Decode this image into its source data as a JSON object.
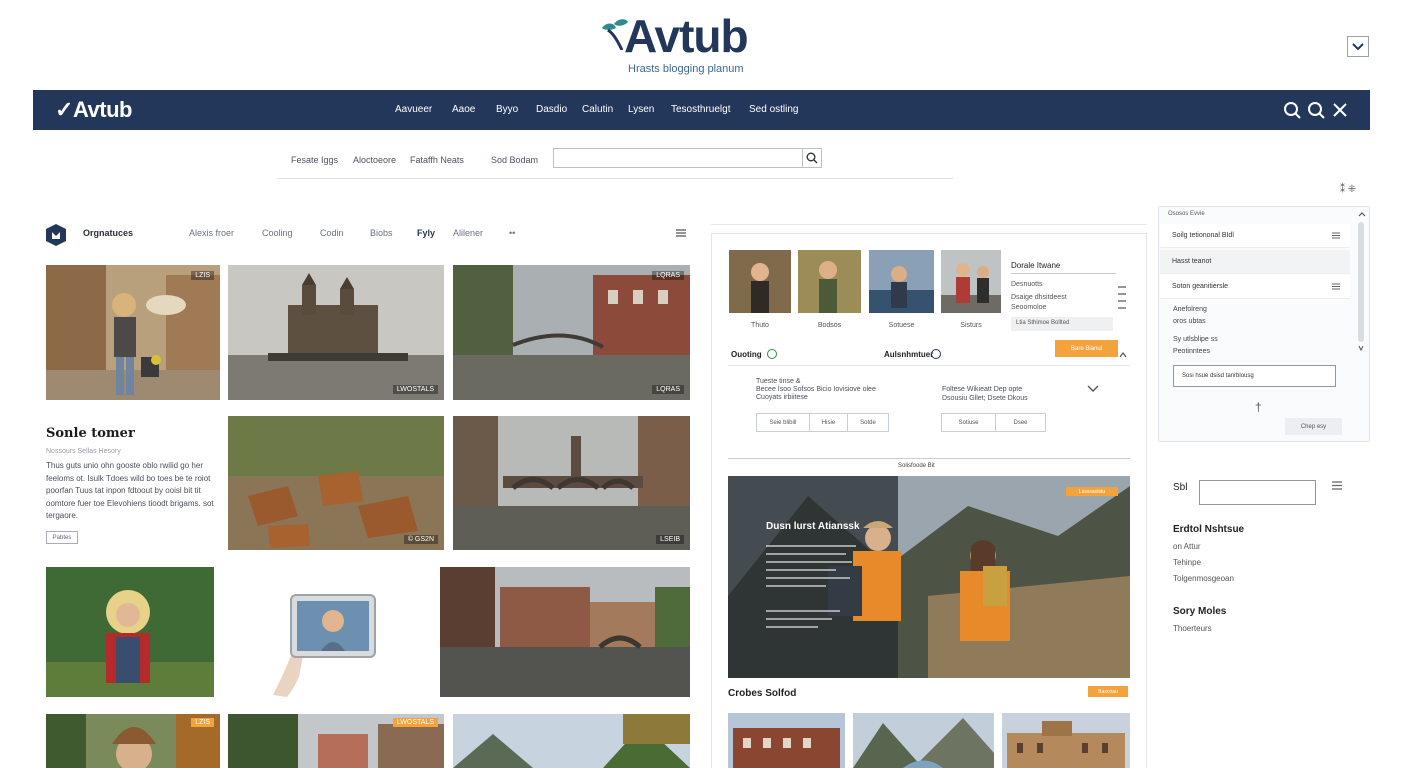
{
  "brand": {
    "name": "Avtub",
    "tagline": "Hrasts blogging planum",
    "nav_logo": "Avtub"
  },
  "nav": {
    "links": [
      "Aavueer",
      "Aaoe",
      "Byyo",
      "Dasdio",
      "Calutin",
      "Lysen",
      "Tesosthruelgt",
      "Sed ostling"
    ]
  },
  "filters": {
    "labels": [
      "Fesate Iggs",
      "Aloctoeore",
      "Fataffh Neats",
      "Sod Bodam"
    ],
    "search_placeholder": ""
  },
  "categories": {
    "items": [
      "Orgnatuces",
      "Alexis froer",
      "Cooling",
      "Codin",
      "Biobs",
      "Fyly",
      "Alilener",
      "••"
    ]
  },
  "photo_tags": [
    "LZIS",
    "LWOSTALS",
    "LQRAS",
    "© GS2N",
    "LSEIB"
  ],
  "article": {
    "title": "Sonle tomer",
    "meta": "Nossours   Sellas Hesory",
    "body": "Thus guts unio ohn gooste oblo rwilid go her feeloms ot. Isulk Tdoes wild bo toes be te roiot poorfan Tuus tat inpon fdtoout by ooisl bit tit oomtore fuer toe Elevohiens tioodt brigams. sot tergaore.",
    "button": "Pabtes"
  },
  "profile_grid": {
    "captions": [
      "Thuto",
      "Bodsos",
      "Sotuese",
      "Sisturs"
    ],
    "info_name": "Dorale Itwane",
    "info_lines": [
      "Desnuotts",
      "Dsaige dhsitdeest",
      "Seoomoloe"
    ],
    "info_input": "Ltia Sthimoe Bollted"
  },
  "tabs": {
    "labels": [
      "Ouoting",
      "Aulsnhmtuer"
    ],
    "button": "Bare Bianul"
  },
  "options": {
    "left_text": [
      "Tueste tinse &",
      "Becee Isoo Sofsos Bicio Iovisiove olee",
      "Cuoyats irbiitese"
    ],
    "left_segments": [
      "Seie blibill",
      "Hisie",
      "Sotde"
    ],
    "right_text": [
      "Foltese Wikieatt Dep opte",
      "Dsousiu Gllet; Dsete Dkous"
    ],
    "right_segments": [
      "Sotiuse",
      "Dsee"
    ],
    "caption": "Solisfoode Bit"
  },
  "hero": {
    "title": "Dusn lurst Atianssk",
    "tag": "Lasssaolstu"
  },
  "mid_bottom": {
    "title": "Crobes Solfod",
    "button": "Bascoau"
  },
  "sidebar": {
    "header": "Ososos Evvie",
    "rows": [
      "Soilg tetiononal BIdl",
      "Hasst teanot",
      "Soton geanitiersle"
    ],
    "texts": [
      "Anefolreng",
      "oros ubtas",
      "Sy utlsblipe ss",
      "Peotinntees"
    ],
    "input_value": "Sosi hsue dsisd tanrblousg",
    "button": "Chep esy"
  },
  "sidebar2": {
    "label": "Sbl",
    "heading1": "Erdtol Nshtsue",
    "items1": [
      "on Attur",
      "Tehinpe",
      "Tolgenmosgeoan"
    ],
    "heading2": "Sory Moles",
    "items2": [
      "Thoerteurs"
    ]
  },
  "colors": {
    "navy": "#22375a",
    "accent_orange": "#f4a23b",
    "check_green": "#2c8a3b"
  }
}
